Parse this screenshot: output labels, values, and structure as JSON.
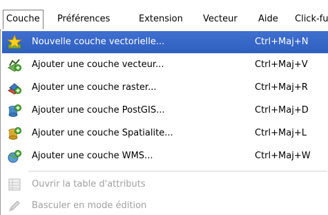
{
  "menubar": {
    "items": [
      {
        "label": "Couche",
        "active": true
      },
      {
        "label": "Préférences"
      },
      {
        "label": "Extension"
      },
      {
        "label": "Vecteur"
      },
      {
        "label": "Aide"
      },
      {
        "label": "Click-fu"
      }
    ]
  },
  "menu": {
    "items": [
      {
        "label": "Nouvelle couche vectorielle...",
        "shortcut": "Ctrl+Maj+N",
        "icon": "star-new-layer-icon",
        "highlighted": true
      },
      {
        "label": "Ajouter une couche vecteur...",
        "shortcut": "Ctrl+Maj+V",
        "icon": "add-vector-layer-icon"
      },
      {
        "label": "Ajouter une couche raster...",
        "shortcut": "Ctrl+Maj+R",
        "icon": "add-raster-layer-icon"
      },
      {
        "label": "Ajouter une couche PostGIS...",
        "shortcut": "Ctrl+Maj+D",
        "icon": "add-postgis-layer-icon"
      },
      {
        "label": "Ajouter une couche Spatialite...",
        "shortcut": "Ctrl+Maj+L",
        "icon": "add-spatialite-layer-icon"
      },
      {
        "label": "Ajouter une couche WMS...",
        "shortcut": "Ctrl+Maj+W",
        "icon": "add-wms-layer-icon"
      },
      {
        "label": "Ouvrir la table d'attributs",
        "shortcut": "",
        "icon": "attribute-table-icon",
        "disabled": true
      },
      {
        "label": "Basculer en mode édition",
        "shortcut": "",
        "icon": "pencil-edit-icon",
        "disabled": true
      }
    ]
  },
  "colors": {
    "highlight": "#3366cc",
    "disabled_text": "#a0a0a0"
  }
}
